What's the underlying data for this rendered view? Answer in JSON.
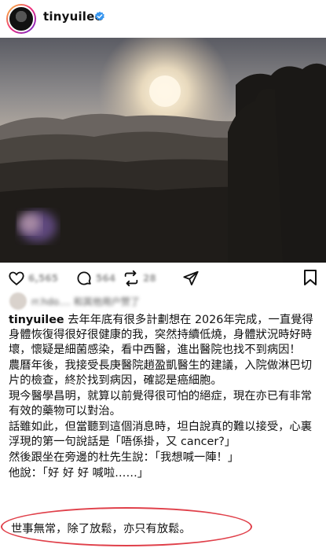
{
  "header": {
    "username": "tinyuilee",
    "verified_color": "#3897f0"
  },
  "photo": {
    "description_icon": "sunset-photo"
  },
  "actions": {
    "like_count": "6,565",
    "comment_count": "564",
    "share_count": "28"
  },
  "liked_by": {
    "text": "rr.hdo.... 和其他用户赞了"
  },
  "caption": {
    "username": "tinyuilee",
    "lines": [
      "去年年底有很多計劃想在 2026年完成，一直覺得身體恢復得很好很健康的我，突然持續低燒，身體狀況時好時壞，懷疑是細菌感染，看中西醫，進出醫院也找不到病因！",
      "農曆年後，我接受長庚醫院趙盈凱醫生的建議，入院做淋巴切片的檢查，終於找到病因，確認是癌細胞。",
      "現今醫學昌明，就算以前覺得很可怕的絕症，現在亦已有非常有效的藥物可以對治。",
      "話雖如此，但當聽到這個消息時，坦白說真的難以接受，心裏浮現的第一句說話是「唔係掛，又 cancer?」",
      "然後跟坐在旁邊的杜先生說：「我想喊一陣！」",
      "他說：「好 好 好 喊啦……」"
    ],
    "final_line": "世事無常，除了放鬆，亦只有放鬆。"
  },
  "colors": {
    "highlight": "#e0404a"
  }
}
